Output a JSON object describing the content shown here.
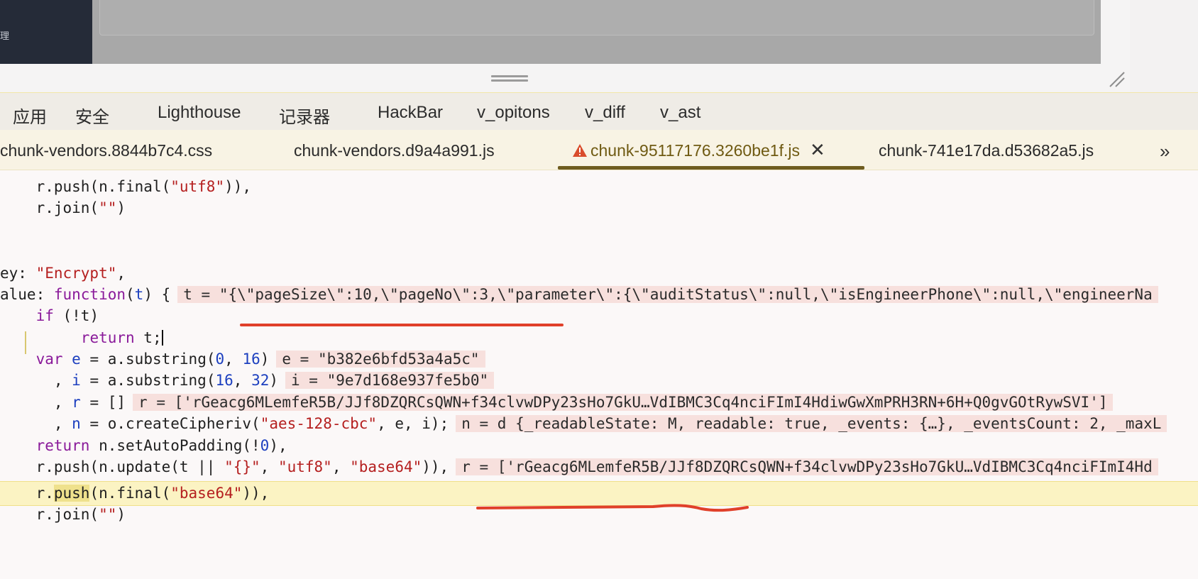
{
  "app": {
    "sidebar_label": "理"
  },
  "devtools_tabs": [
    "应用",
    "安全",
    "Lighthouse",
    "记录器",
    "HackBar",
    "v_opitons",
    "v_diff",
    "v_ast"
  ],
  "file_tabs": {
    "items": [
      "chunk-vendors.8844b7c4.css",
      "chunk-vendors.d9a4a991.js",
      "chunk-95117176.3260be1f.js",
      "chunk-741e17da.d53682a5.js"
    ],
    "active": "chunk-95117176.3260be1f.js",
    "close_glyph": "✕",
    "more_glyph": "»"
  },
  "code": {
    "l1_fn": "push",
    "l1_str": "\"utf8\"",
    "l2_str": "\"\"",
    "l3_key": "ey: ",
    "l3_str": "\"Encrypt\"",
    "l4_key": "alue: ",
    "l4_kw": "function",
    "l4_param": "t",
    "l4_inline": "t = \"{\\\"pageSize\\\":10,\\\"pageNo\\\":3,\\\"parameter\\\":{\\\"auditStatus\\\":null,\\\"isEngineerPhone\\\":null,\\\"engineerNa",
    "l5_kw": "if",
    "l6_kw": "return",
    "l7_kw": "var",
    "l7_var": "e",
    "l7_n1": "0",
    "l7_n2": "16",
    "l7_inline": "e = \"b382e6bfd53a4a5c\"",
    "l8_var": "i",
    "l8_n1": "16",
    "l8_n2": "32",
    "l8_inline": "i = \"9e7d168e937fe5b0\"",
    "l9_var": "r",
    "l9_inline": "r = ['rGeacg6MLemfeR5B/JJf8DZQRCsQWN+f34clvwDPy23sHo7GkU…VdIBMC3Cq4nciFImI4HdiwGwXmPRH3RN+6H+Q0gvGOtRywSVI']",
    "l10_var": "n",
    "l10_s1": "\"aes-128-cbc\"",
    "l10_inline": "n = d {_readableState: M, readable: true, _events: {…}, _eventsCount: 2, _maxL",
    "l11_kw": "return",
    "l11_num": "0",
    "l12_s1": "\"{}\"",
    "l12_s2": "\"utf8\"",
    "l12_s3": "\"base64\"",
    "l12_inline": "r = ['rGeacg6MLemfeR5B/JJf8DZQRCsQWN+f34clvwDPy23sHo7GkU…VdIBMC3Cq4nciFImI4Hd",
    "l13_hit": "push",
    "l13_str": "\"base64\"",
    "l14_str": "\"\""
  },
  "colors": {
    "string": "#b51f1f",
    "keyword": "#8a1a9a",
    "number": "#1c3fbf",
    "annotation": "#e0402a"
  }
}
